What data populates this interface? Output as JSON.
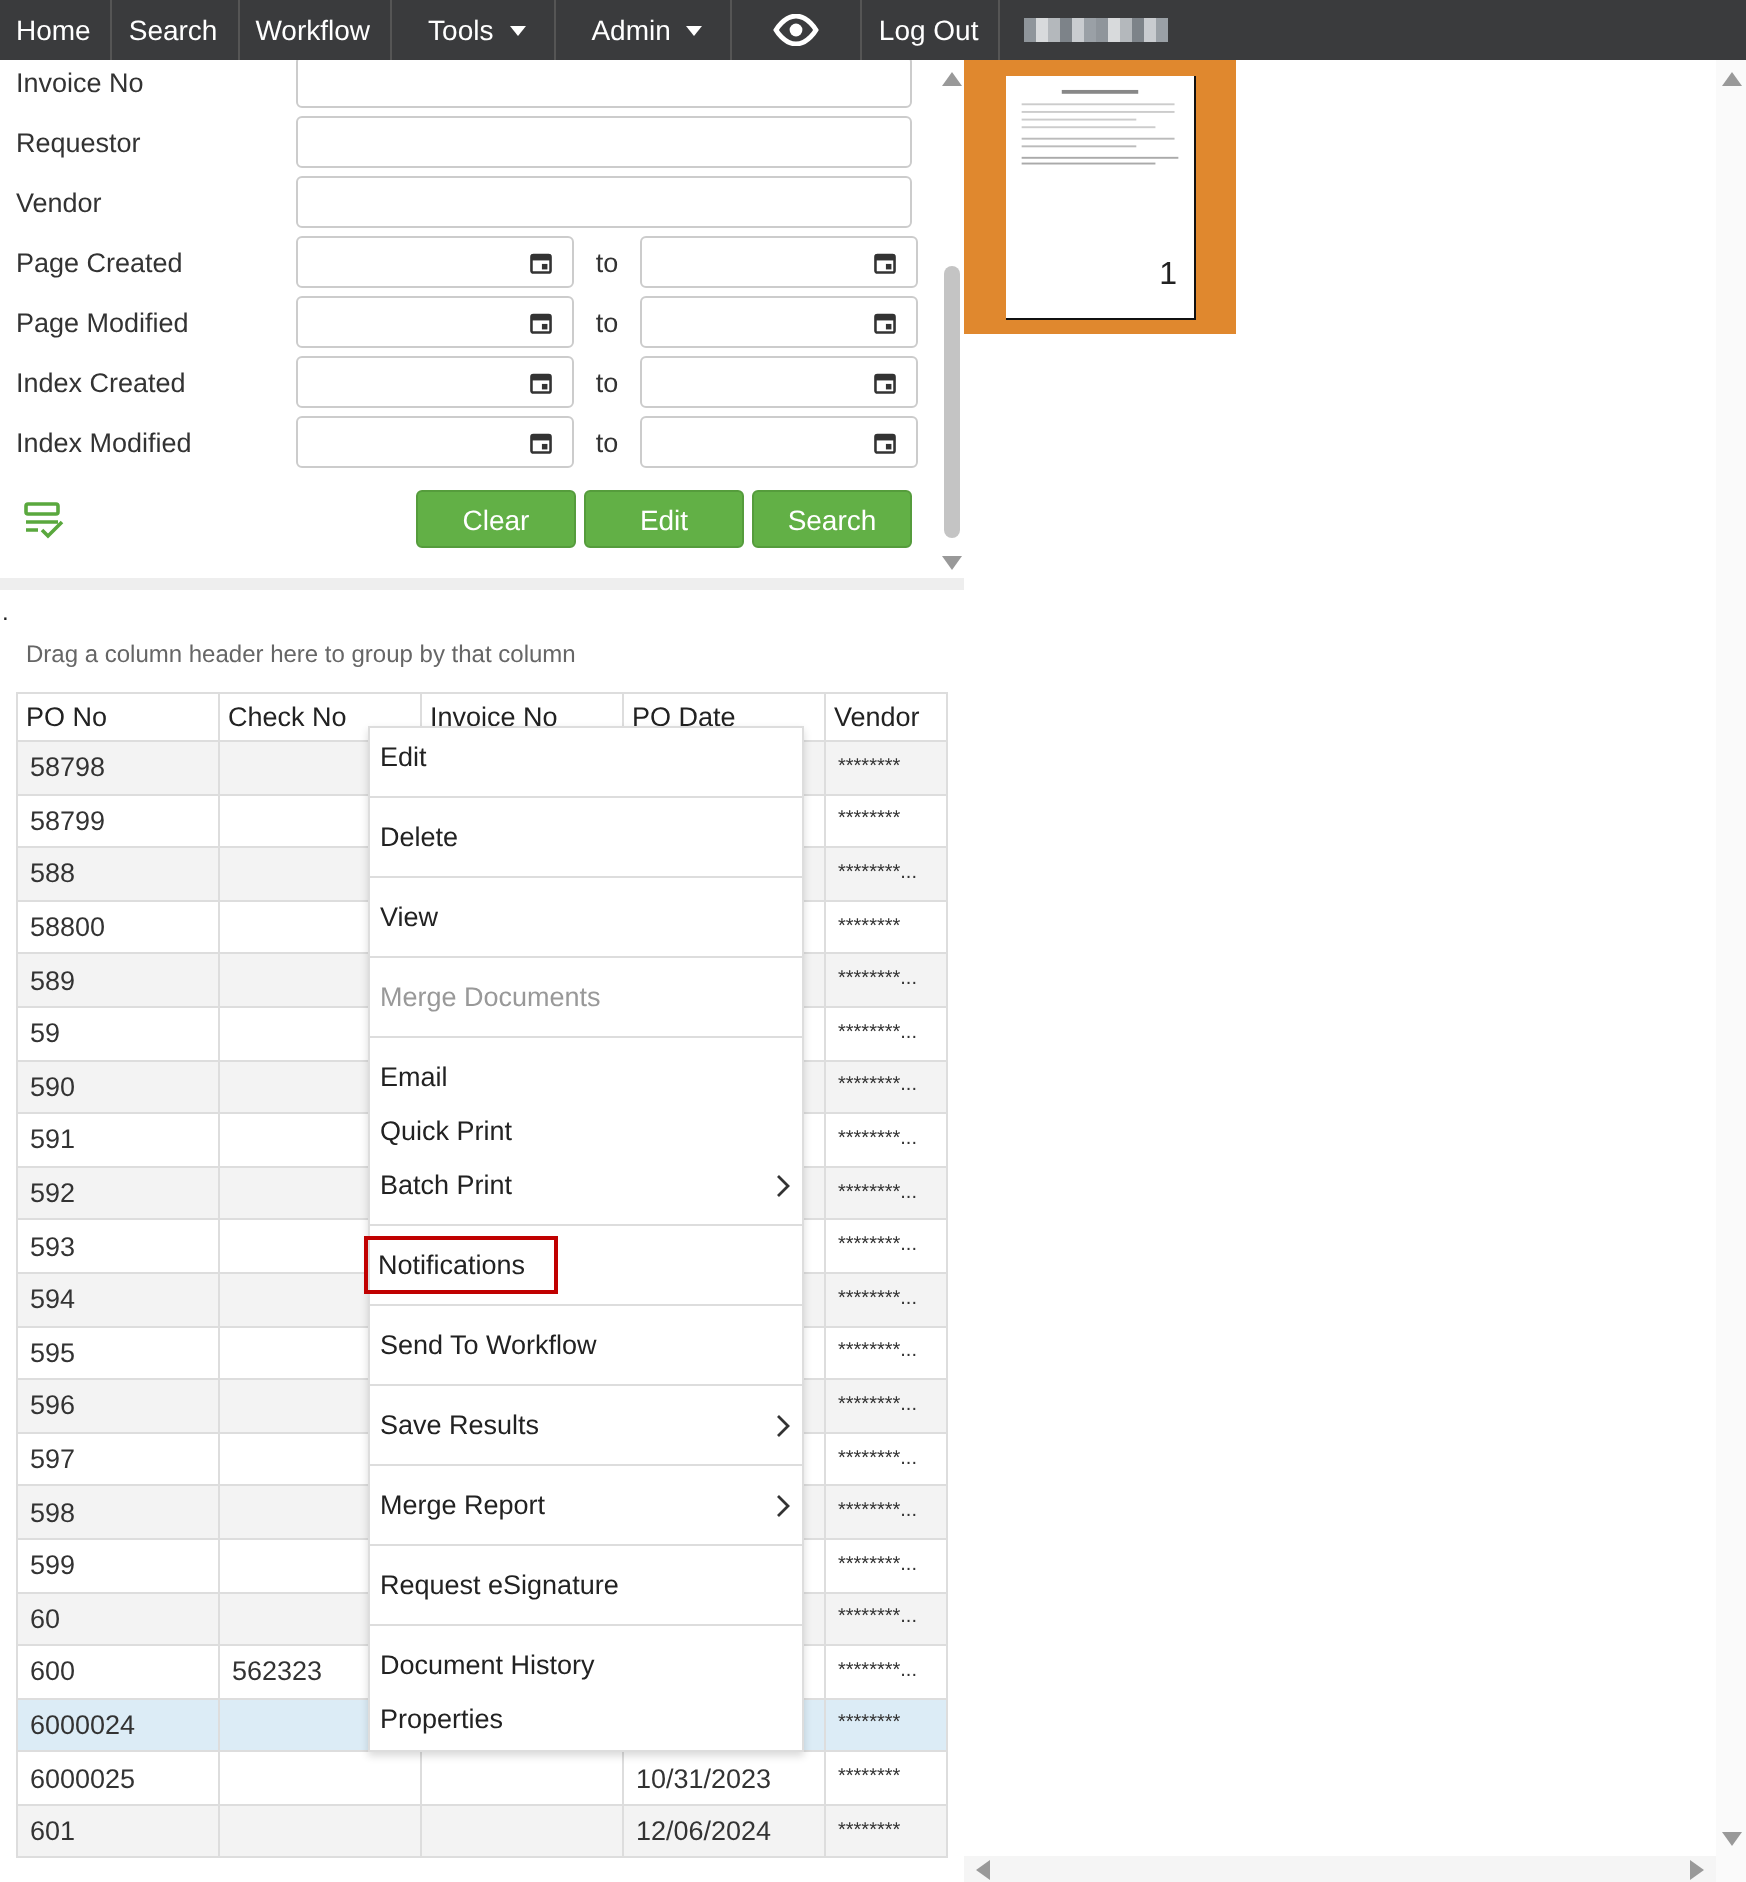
{
  "nav": [
    {
      "kind": "link",
      "label": "Home"
    },
    {
      "kind": "link",
      "label": "Search"
    },
    {
      "kind": "link",
      "label": "Workflow"
    },
    {
      "kind": "dropdown",
      "label": "Tools"
    },
    {
      "kind": "dropdown",
      "label": "Admin"
    },
    {
      "kind": "icon"
    },
    {
      "kind": "link",
      "label": "Log Out"
    },
    {
      "kind": "redacted"
    }
  ],
  "search_form": {
    "fields": [
      {
        "kind": "text",
        "label": "Invoice No"
      },
      {
        "kind": "text",
        "label": "Requestor"
      },
      {
        "kind": "text",
        "label": "Vendor"
      },
      {
        "kind": "date_range",
        "label": "Page Created",
        "separator": "to"
      },
      {
        "kind": "date_range",
        "label": "Page Modified",
        "separator": "to"
      },
      {
        "kind": "date_range",
        "label": "Index Created",
        "separator": "to"
      },
      {
        "kind": "date_range",
        "label": "Index Modified",
        "separator": "to"
      }
    ],
    "buttons": [
      "Clear",
      "Edit",
      "Search"
    ]
  },
  "grid": {
    "marker": ".",
    "group_hint": "Drag a column header here to group by that column",
    "columns": [
      "PO No",
      "Check No",
      "Invoice No",
      "PO Date",
      "Vendor"
    ],
    "rows": [
      {
        "po_no": "58798",
        "vendor": "********",
        "selected": false
      },
      {
        "po_no": "58799",
        "vendor": "********",
        "selected": false
      },
      {
        "po_no": "588",
        "vendor": "********...",
        "selected": false
      },
      {
        "po_no": "58800",
        "vendor": "********",
        "selected": false
      },
      {
        "po_no": "589",
        "vendor": "********...",
        "selected": false
      },
      {
        "po_no": "59",
        "vendor": "********...",
        "selected": false
      },
      {
        "po_no": "590",
        "vendor": "********...",
        "selected": false
      },
      {
        "po_no": "591",
        "vendor": "********...",
        "selected": false
      },
      {
        "po_no": "592",
        "vendor": "********...",
        "selected": false
      },
      {
        "po_no": "593",
        "vendor": "********...",
        "selected": false
      },
      {
        "po_no": "594",
        "vendor": "********...",
        "selected": false
      },
      {
        "po_no": "595",
        "vendor": "********...",
        "selected": false
      },
      {
        "po_no": "596",
        "vendor": "********...",
        "selected": false
      },
      {
        "po_no": "597",
        "vendor": "********...",
        "selected": false
      },
      {
        "po_no": "598",
        "vendor": "********...",
        "selected": false
      },
      {
        "po_no": "599",
        "vendor": "********...",
        "selected": false
      },
      {
        "po_no": "60",
        "vendor": "********...",
        "selected": false
      },
      {
        "po_no": "600",
        "check_no": "562323",
        "vendor": "********...",
        "selected": false
      },
      {
        "po_no": "6000024",
        "vendor": "********",
        "selected": true
      },
      {
        "po_no": "6000025",
        "po_date": "10/31/2023",
        "vendor": "********",
        "selected": false
      },
      {
        "po_no": "601",
        "po_date": "12/06/2024",
        "vendor": "********",
        "selected": false
      }
    ]
  },
  "context_menu": {
    "groups": [
      [
        {
          "label": "Edit",
          "disabled": false,
          "submenu": false,
          "highlighted": false
        }
      ],
      [
        {
          "label": "Delete",
          "disabled": false,
          "submenu": false,
          "highlighted": false
        }
      ],
      [
        {
          "label": "View",
          "disabled": false,
          "submenu": false,
          "highlighted": false
        }
      ],
      [
        {
          "label": "Merge Documents",
          "disabled": true,
          "submenu": false,
          "highlighted": false
        }
      ],
      [
        {
          "label": "Email",
          "disabled": false,
          "submenu": false,
          "highlighted": false
        },
        {
          "label": "Quick Print",
          "disabled": false,
          "submenu": false,
          "highlighted": false
        },
        {
          "label": "Batch Print",
          "disabled": false,
          "submenu": true,
          "highlighted": false
        }
      ],
      [
        {
          "label": "Notifications",
          "disabled": false,
          "submenu": false,
          "highlighted": true
        }
      ],
      [
        {
          "label": "Send To Workflow",
          "disabled": false,
          "submenu": false,
          "highlighted": false
        }
      ],
      [
        {
          "label": "Save Results",
          "disabled": false,
          "submenu": true,
          "highlighted": false
        }
      ],
      [
        {
          "label": "Merge Report",
          "disabled": false,
          "submenu": true,
          "highlighted": false
        }
      ],
      [
        {
          "label": "Request eSignature",
          "disabled": false,
          "submenu": false,
          "highlighted": false
        }
      ],
      [
        {
          "label": "Document History",
          "disabled": false,
          "submenu": false,
          "highlighted": false
        },
        {
          "label": "Properties",
          "disabled": false,
          "submenu": false,
          "highlighted": false
        }
      ]
    ]
  },
  "viewer": {
    "pages": [
      {
        "number": "1",
        "selected": true
      }
    ]
  }
}
